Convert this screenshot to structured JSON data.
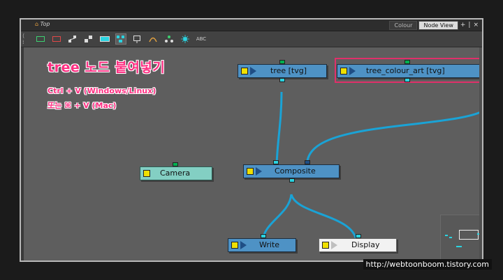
{
  "window": {
    "breadcrumb": "Top",
    "tabs": [
      {
        "label": "Colour",
        "active": false
      },
      {
        "label": "Node View",
        "active": true
      }
    ],
    "tab_buttons": [
      "+",
      "|",
      "×"
    ]
  },
  "toolbar": {
    "tools": [
      "composite-node-icon",
      "color-card-icon",
      "peg-icon",
      "element-peg-icon",
      "drawing-node-icon",
      "group-node-icon",
      "display-node-icon",
      "deformation-icon",
      "network-icon",
      "effects-icon",
      "abc-label-icon"
    ],
    "selected_tool_index": 5
  },
  "annotation": {
    "title": "tree 노드 붙여넣기",
    "line1": "Ctrl + V (Windows/Linux)",
    "line2": "또는 ⌘ + V (Mac)"
  },
  "nodes": {
    "tree": {
      "label": "tree  [tvg]"
    },
    "tree_colour_art": {
      "label": "tree_colour_art  [tvg]"
    },
    "camera": {
      "label": "Camera"
    },
    "composite": {
      "label": "Composite"
    },
    "write": {
      "label": "Write"
    },
    "display": {
      "label": "Display"
    }
  },
  "colors": {
    "node_blue": "#4e92c5",
    "camera_cyan": "#83cfc3",
    "wire": "#1aa3d6",
    "highlight": "#e0306a",
    "annotation_pink": "#ff2f82"
  },
  "watermark": "http://webtoonboom.tistory.com"
}
